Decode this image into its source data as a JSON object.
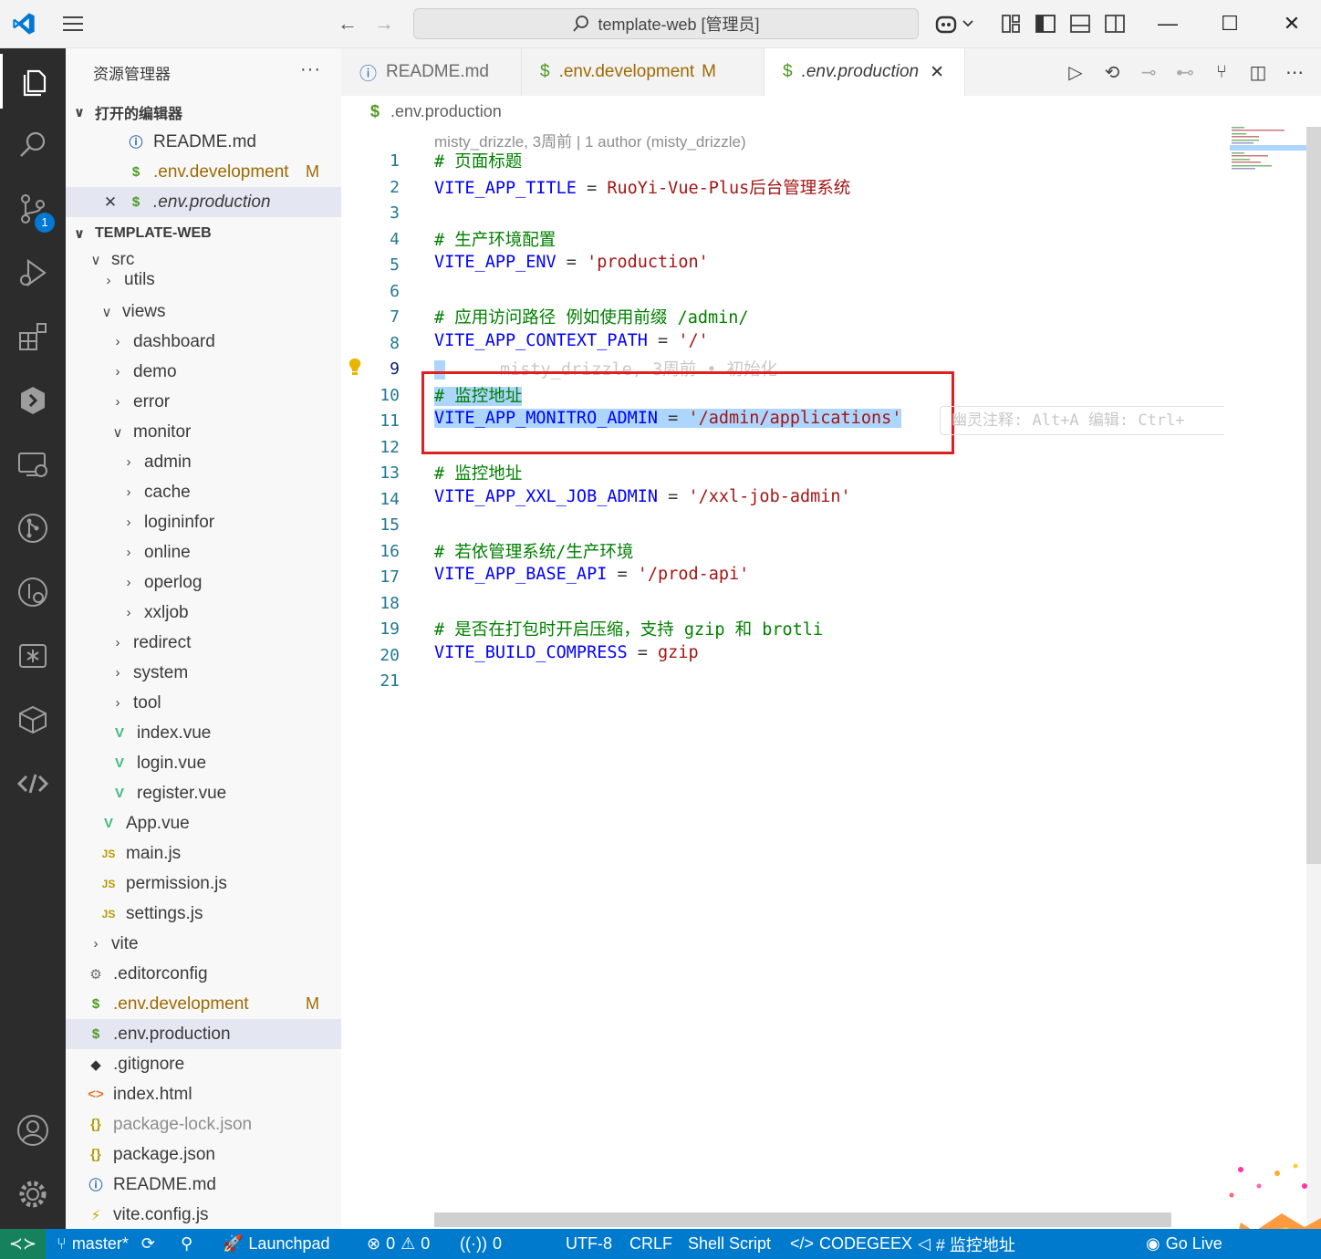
{
  "titlebar": {
    "search_text": "template-web [管理员]",
    "nav_back": "←",
    "nav_forward": "→",
    "minimize": "—",
    "maximize": "☐",
    "close": "✕"
  },
  "activitybar": {
    "scm_badge": "1"
  },
  "sidebar": {
    "title": "资源管理器",
    "more": "···",
    "open_editors_label": "打开的编辑器",
    "open_editors": [
      {
        "name": "README.md",
        "icon": "ⓘ",
        "modified": ""
      },
      {
        "name": ".env.development",
        "icon": "$",
        "modified": "M"
      },
      {
        "name": ".env.production",
        "icon": "$",
        "modified": "",
        "close": "✕"
      }
    ],
    "workspace_label": "TEMPLATE-WEB",
    "tree": {
      "src": "src",
      "utils": "utils",
      "views": "views",
      "dashboard": "dashboard",
      "demo": "demo",
      "error": "error",
      "monitor": "monitor",
      "admin": "admin",
      "cache": "cache",
      "logininfor": "logininfor",
      "online": "online",
      "operlog": "operlog",
      "xxljob": "xxljob",
      "redirect": "redirect",
      "system": "system",
      "tool": "tool",
      "index_vue": "index.vue",
      "login_vue": "login.vue",
      "register_vue": "register.vue",
      "app_vue": "App.vue",
      "main_js": "main.js",
      "permission_js": "permission.js",
      "settings_js": "settings.js",
      "vite": "vite",
      "editorconfig": ".editorconfig",
      "env_development": ".env.development",
      "env_development_mod": "M",
      "env_production": ".env.production",
      "gitignore": ".gitignore",
      "index_html": "index.html",
      "package_lock": "package-lock.json",
      "package_json": "package.json",
      "readme": "README.md",
      "vite_config": "vite.config.js"
    }
  },
  "tabs": [
    {
      "label": "README.md",
      "icon": "ⓘ",
      "modified": ""
    },
    {
      "label": ".env.development",
      "icon": "$",
      "modified": "M"
    },
    {
      "label": ".env.production",
      "icon": "$",
      "modified": "",
      "close": "✕"
    }
  ],
  "breadcrumb": {
    "icon": "$",
    "file": ".env.production"
  },
  "editor": {
    "blame_header": "misty_drizzle, 3周前 | 1 author (misty_drizzle)",
    "inline_blame": "misty_drizzle, 3周前 • 初始化",
    "ghost_hint": "幽灵注释: Alt+A 编辑: Ctrl+",
    "lines": {
      "n1": "1",
      "n2": "2",
      "n3": "3",
      "n4": "4",
      "n5": "5",
      "n6": "6",
      "n7": "7",
      "n8": "8",
      "n9": "9",
      "n10": "10",
      "n11": "11",
      "n12": "12",
      "n13": "13",
      "n14": "14",
      "n15": "15",
      "n16": "16",
      "n17": "17",
      "n18": "18",
      "n19": "19",
      "n20": "20",
      "n21": "21"
    },
    "code": {
      "l1_comment": "# 页面标题",
      "l2_key": "VITE_APP_TITLE",
      "l2_eq": " = ",
      "l2_val": "RuoYi-Vue-Plus后台管理系统",
      "l4_comment": "# 生产环境配置",
      "l5_key": "VITE_APP_ENV",
      "l5_eq": " = ",
      "l5_val": "'production'",
      "l7_comment": "# 应用访问路径 例如使用前缀 /admin/",
      "l8_key": "VITE_APP_CONTEXT_PATH",
      "l8_eq": " = ",
      "l8_val": "'/'",
      "l10_comment": "# 监控地址",
      "l11_key": "VITE_APP_MONITRO_ADMIN",
      "l11_eq": " = ",
      "l11_val": "'/admin/applications'",
      "l13_comment": "# 监控地址",
      "l14_key": "VITE_APP_XXL_JOB_ADMIN",
      "l14_eq": " = ",
      "l14_val": "'/xxl-job-admin'",
      "l16_comment": "# 若依管理系统/生产环境",
      "l17_key": "VITE_APP_BASE_API",
      "l17_eq": " = ",
      "l17_val": "'/prod-api'",
      "l19_comment": "# 是否在打包时开启压缩，支持 gzip 和 brotli",
      "l20_key": "VITE_BUILD_COMPRESS",
      "l20_eq": " = ",
      "l20_val": "gzip"
    }
  },
  "statusbar": {
    "remote": "≺≻",
    "branch": "master*",
    "launchpad": "Launchpad",
    "errors": "0",
    "warnings": "0",
    "ports": "0",
    "encoding": "UTF-8",
    "eol": "CRLF",
    "language": "Shell Script",
    "codegeex": "CODEGEEX",
    "symbol": "# 监控地址",
    "golive": "Go Live"
  },
  "colors": {
    "activitybar": "#2c2c2c",
    "statusbar": "#007acc",
    "remote": "#16825d",
    "selection": "#add6ff",
    "highlight_box": "#e02020"
  }
}
